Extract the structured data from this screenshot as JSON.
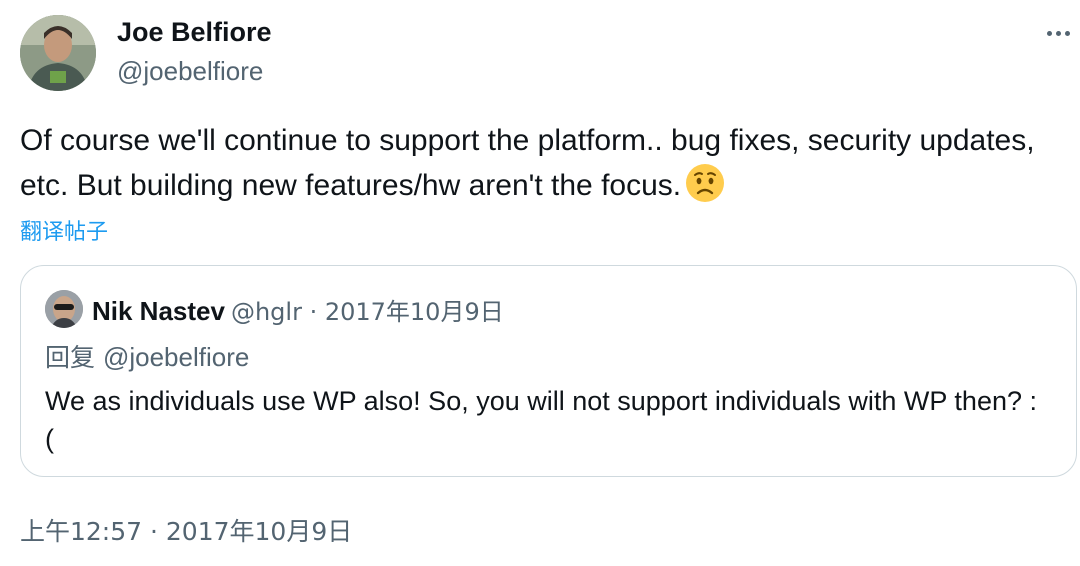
{
  "author": {
    "name": "Joe Belfiore",
    "handle": "@joebelfiore"
  },
  "tweet": {
    "text": "Of course we'll continue to support the platform.. bug fixes, security updates, etc. But building new features/hw aren't the focus.",
    "emoji": "worried-face-emoji",
    "translate_label": "翻译帖子",
    "timestamp": "上午12:57 · 2017年10月9日"
  },
  "quoted": {
    "name": "Nik Nastev",
    "meta": "@hglr · 2017年10月9日",
    "reply_prefix": "回复",
    "reply_to": "@joebelfiore",
    "text": "We as individuals use WP also! So, you will not support individuals with WP then? :("
  },
  "icons": {
    "more": "more-horizontal-icon"
  },
  "colors": {
    "text": "#0f1419",
    "secondary": "#536471",
    "link": "#1d9bf0",
    "border": "#cfd9de"
  }
}
